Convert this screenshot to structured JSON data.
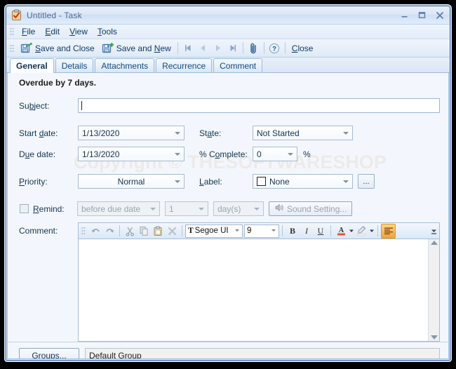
{
  "window": {
    "title": "Untitled - Task",
    "icon": "task-clipboard-icon",
    "minimize": "–",
    "maximize": "❑",
    "close": "✕"
  },
  "menubar": {
    "items": [
      {
        "name": "file",
        "label": "File",
        "accel": "F"
      },
      {
        "name": "edit",
        "label": "Edit",
        "accel": "E"
      },
      {
        "name": "view",
        "label": "View",
        "accel": "V"
      },
      {
        "name": "tools",
        "label": "Tools",
        "accel": "T"
      }
    ]
  },
  "toolbar": {
    "save_and_close": "Save and Close",
    "save_and_new": "Save and New",
    "nav_first": "first-record-icon",
    "nav_prev": "previous-record-icon",
    "nav_next": "next-record-icon",
    "nav_last": "last-record-icon",
    "attach": "paperclip-icon",
    "help": "help-icon",
    "close": "Close"
  },
  "tabs": [
    {
      "name": "general",
      "label": "General",
      "active": true
    },
    {
      "name": "details",
      "label": "Details",
      "active": false
    },
    {
      "name": "attachments",
      "label": "Attachments",
      "active": false
    },
    {
      "name": "recurrence",
      "label": "Recurrence",
      "active": false
    },
    {
      "name": "comment",
      "label": "Comment",
      "active": false
    }
  ],
  "general": {
    "status_banner": "Overdue by 7 days.",
    "subject_label": "Subject:",
    "subject_value": "",
    "start_date_label": "Start date:",
    "start_date_value": "1/13/2020",
    "due_date_label": "Due date:",
    "due_date_value": "1/13/2020",
    "state_label": "State:",
    "state_value": "Not Started",
    "percent_complete_label": "% Complete:",
    "percent_complete_value": "0",
    "percent_sign": "%",
    "priority_label": "Priority:",
    "priority_value": "Normal",
    "label_label": "Label:",
    "label_value": "None",
    "label_color": "#ffffff",
    "label_browse": "...",
    "remind_label": "Remind:",
    "remind_checked": false,
    "remind_when_value": "before due date",
    "remind_count_value": "1",
    "remind_unit_value": "day(s)",
    "sound_setting": "Sound Setting..."
  },
  "comment": {
    "label": "Comment:",
    "text": "",
    "toolbar": {
      "undo": "undo-icon",
      "redo": "redo-icon",
      "cut": "cut-scissors-icon",
      "copy": "copy-icon",
      "paste": "paste-icon",
      "delete": "delete-x-icon",
      "font_family": "Segoe UI",
      "font_size": "9",
      "bold": "B",
      "italic": "I",
      "underline": "U",
      "font_color": "A",
      "highlight": "highlighter-icon",
      "align": "align-left-icon",
      "overflow": "toolbar-overflow-icon"
    }
  },
  "footer": {
    "groups_button": "Groups...",
    "group_value": "Default Group"
  },
  "watermark": "Copyright © THESOFTWARESHOP",
  "colors": {
    "accent": "#416aa3",
    "page_bg": "#f3f7fd",
    "highlight_orange": "#f0a93c"
  }
}
